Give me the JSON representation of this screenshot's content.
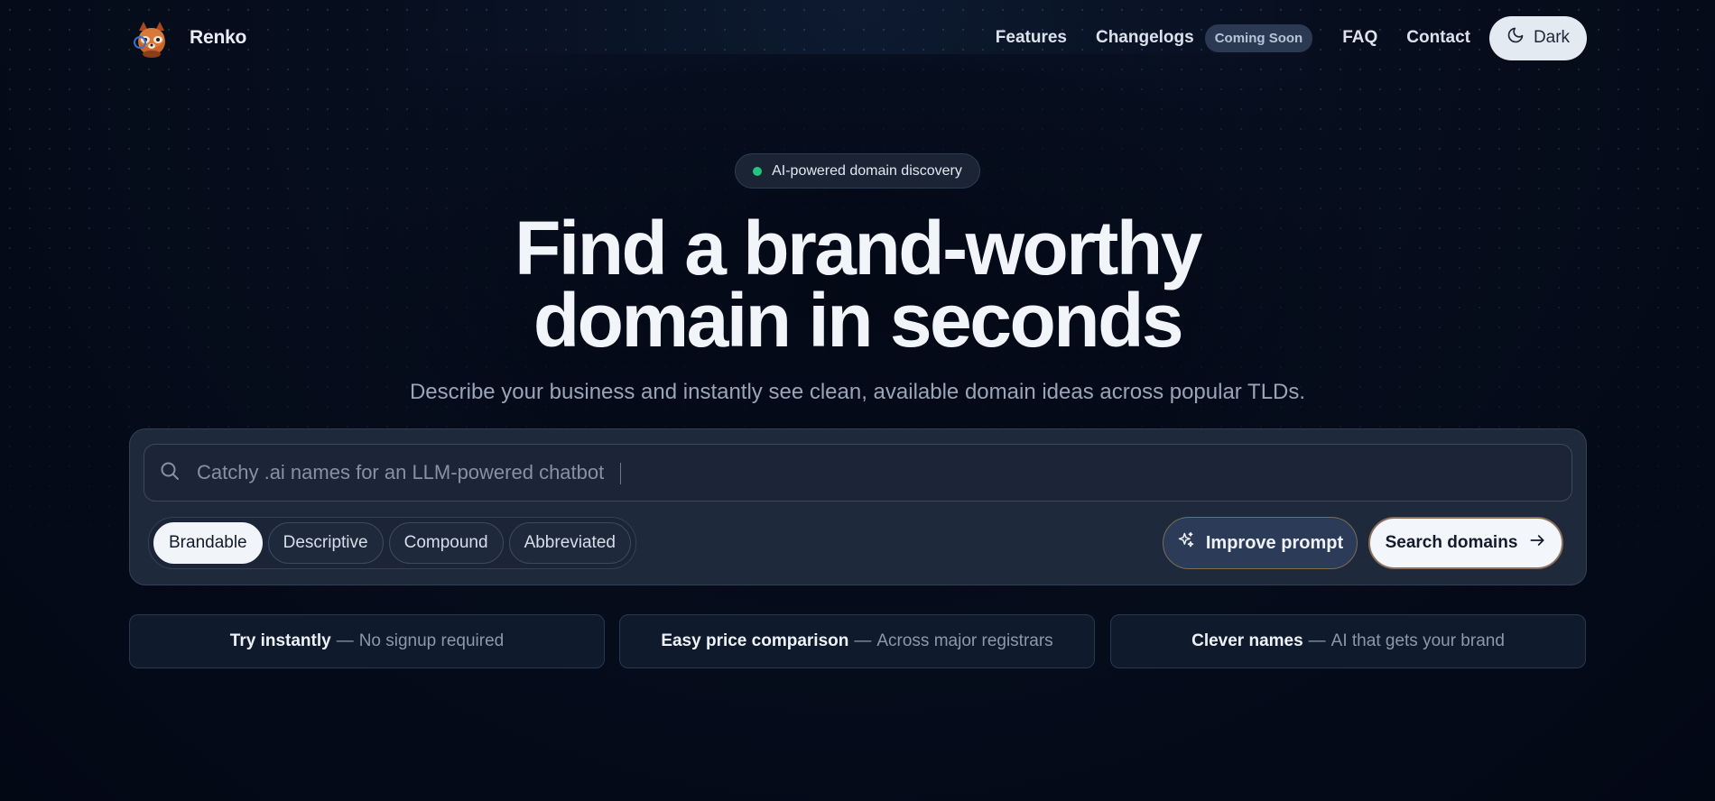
{
  "brand": {
    "name": "Renko",
    "logo_icon": "red-panda-logo-icon"
  },
  "nav": {
    "links": [
      "Features",
      "Changelogs",
      "FAQ",
      "Contact"
    ],
    "coming_soon_badge": "Coming Soon",
    "theme_toggle": {
      "label": "Dark",
      "icon": "moon-icon"
    }
  },
  "hero": {
    "pill": "AI-powered domain discovery",
    "headline_line1": "Find a brand-worthy",
    "headline_line2": "domain in seconds",
    "subtitle": "Describe your business and instantly see clean, available domain ideas across popular TLDs."
  },
  "search": {
    "placeholder": "Catchy .ai names for an LLM-powered chatbot",
    "value": "",
    "styles": [
      "Brandable",
      "Descriptive",
      "Compound",
      "Abbreviated"
    ],
    "selected_style": "Brandable",
    "improve_label": "Improve prompt",
    "submit_label": "Search domains"
  },
  "features": [
    {
      "title": "Try instantly",
      "desc": "No signup required"
    },
    {
      "title": "Easy price comparison",
      "desc": "Across major registrars"
    },
    {
      "title": "Clever names",
      "desc": "AI that gets your brand"
    }
  ],
  "colors": {
    "background": "#030815",
    "accent_green": "#22c47e",
    "panel": "#1e293b",
    "button_light": "#f3f6fa"
  }
}
